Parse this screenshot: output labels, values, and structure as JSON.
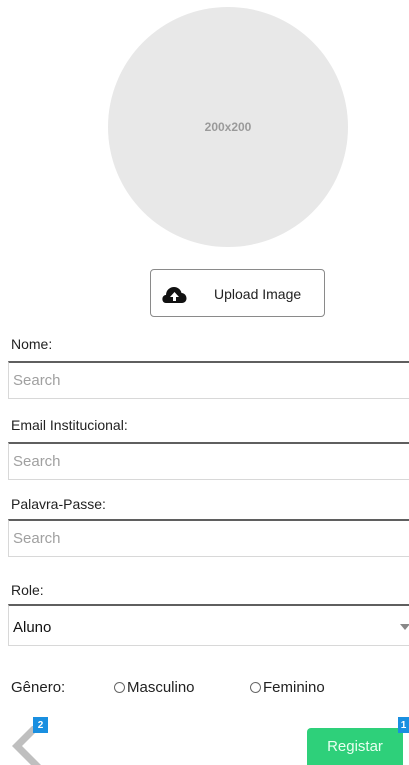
{
  "avatar": {
    "placeholder_text": "200x200"
  },
  "upload": {
    "label": "Upload Image",
    "icon": "cloud-upload-icon"
  },
  "form": {
    "name": {
      "label": "Nome:",
      "placeholder": "Search",
      "value": ""
    },
    "email": {
      "label": "Email Institucional:",
      "placeholder": "Search",
      "value": ""
    },
    "password": {
      "label": "Palavra-Passe:",
      "placeholder": "Search",
      "value": ""
    },
    "role": {
      "label": "Role:",
      "selected": "Aluno"
    },
    "gender": {
      "label": "Gênero:",
      "options": [
        {
          "label": "Masculino",
          "checked": false
        },
        {
          "label": "Feminino",
          "checked": false
        }
      ]
    }
  },
  "footer": {
    "back_badge": "2",
    "submit_badge": "1",
    "submit_label": "Registar",
    "submit_color": "#2ed07a",
    "badge_color": "#1a8fe0"
  }
}
